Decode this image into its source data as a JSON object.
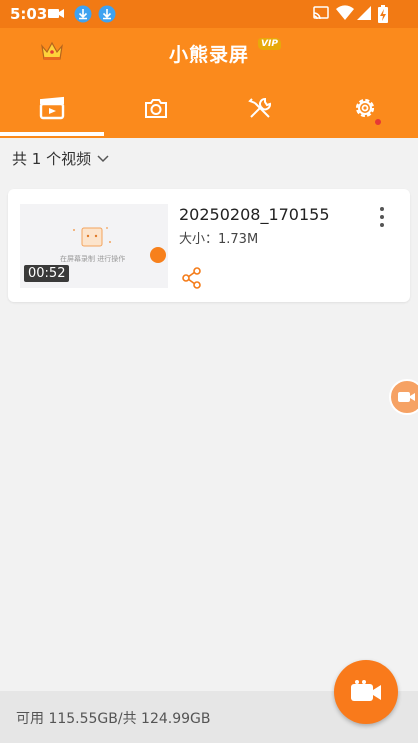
{
  "status_bar": {
    "time": "5:03",
    "left_icons": [
      "video-camera-icon",
      "download-icon",
      "download-icon"
    ],
    "right_icons": [
      "cast-icon",
      "wifi-icon",
      "signal-icon",
      "battery-charging-icon"
    ]
  },
  "header": {
    "title": "小熊录屏",
    "vip_badge": "VIP",
    "crown_icon": "crown-icon",
    "accent_color": "#fb8a1c"
  },
  "tabs": [
    {
      "name": "videos",
      "icon": "clapperboard-icon",
      "active": true
    },
    {
      "name": "screenshots",
      "icon": "camera-icon",
      "active": false
    },
    {
      "name": "tools",
      "icon": "tools-icon",
      "active": false
    },
    {
      "name": "settings",
      "icon": "gear-icon",
      "active": false,
      "has_notification": true
    }
  ],
  "filter": {
    "label": "共 1 个视频"
  },
  "videos": [
    {
      "filename": "20250208_170155",
      "size": "大小：1.73M",
      "duration": "00:52",
      "thumbnail_caption": "在屏幕录制 进行操作"
    }
  ],
  "footer": {
    "storage": "可用 115.55GB/共 124.99GB"
  }
}
